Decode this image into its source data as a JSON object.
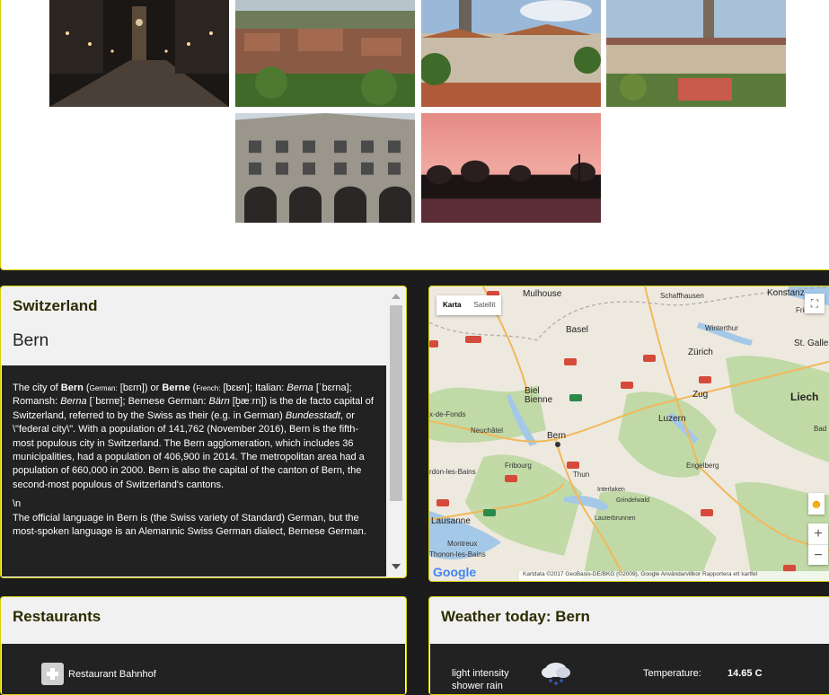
{
  "gallery": {
    "images": [
      {
        "subject": "Bern old town street with clock tower at night"
      },
      {
        "subject": "Bern rooftops panorama"
      },
      {
        "subject": "Bern cathedral and houses"
      },
      {
        "subject": "Bern Federal Palace skyline"
      },
      {
        "subject": "Arcaded building facade"
      },
      {
        "subject": "Sunset over a harbour"
      }
    ]
  },
  "info": {
    "country": "Switzerland",
    "city": "Bern",
    "p1": {
      "a": "The city of ",
      "b": "Bern",
      "c": " (",
      "d": "German:",
      "e": " [bɛrn]) or ",
      "f": "Berne",
      "g": " (",
      "h": "French:",
      "i": " [bɛʁn]; Italian: ",
      "j": "Berna",
      "k": " [ˈbɛrna]; Romansh: ",
      "l": "Berna",
      "m": " [ˈbɛrnɐ]; Bernese German: ",
      "n": "Bärn",
      "o": " [b̥æːrn]) is the de facto capital of Switzerland, referred to by the Swiss as their (e.g. in German) ",
      "p": "Bundesstadt",
      "q": ", or \\\"federal city\\\". With a population of 141,762 (November 2016), Bern is the fifth-most populous city in Switzerland. The Bern agglomeration, which includes 36 municipalities, had a population of 406,900 in 2014. The metropolitan area had a population of 660,000 in 2000. Bern is also the capital of the canton of Bern, the second-most populous of Switzerland's cantons."
    },
    "p2": "\\n",
    "p3": "The official language in Bern is (the Swiss variety of Standard) German, but the most-spoken language is an Alemannic Swiss German dialect, Bernese German."
  },
  "map": {
    "tab_map": "Karta",
    "tab_satellite": "Satellit",
    "labels": {
      "mulhouse": "Mulhouse",
      "schaffhausen": "Schaffhausen",
      "konstanz": "Konstanz",
      "frie": "Frie",
      "basel": "Basel",
      "winterthur": "Winterthur",
      "stgalle": "St. Galle",
      "zurich": "Zürich",
      "zug": "Zug",
      "liech": "Liech",
      "biel": "Biel\nBienne",
      "chauxdefonds": "x-de-Fonds",
      "neuchatel": "Neuchâtel",
      "luzern": "Luzern",
      "bad": "Bad",
      "bern": "Bern",
      "engelberg": "Engelberg",
      "fribourg": "Fribourg",
      "yverdon": "rdon-les-Bains",
      "thun": "Thun",
      "interlaken": "Interlaken",
      "grindelwald": "Grindelwald",
      "lauterbrunnen": "Lauterbrunnen",
      "lausanne": "Lausanne",
      "montreux": "Montreux",
      "thonon": "Thonon-les-Bains"
    },
    "google": "Google",
    "footer": "Kartdata ©2017 GeoBasis-DE/BKG (©2009), Google   Användarvillkor   Rapportera ett kartfel",
    "zoom_in": "+",
    "zoom_out": "−"
  },
  "restaurants": {
    "title": "Restaurants",
    "items": [
      {
        "name": "Restaurant Bahnhof"
      }
    ]
  },
  "weather": {
    "title": "Weather today: Bern",
    "condition": "light intensity shower rain",
    "temperature_label": "Temperature:",
    "temperature_value": "14.65 C"
  },
  "colors": {
    "accent_border": "#d8d000",
    "dark_bg": "#222222"
  }
}
